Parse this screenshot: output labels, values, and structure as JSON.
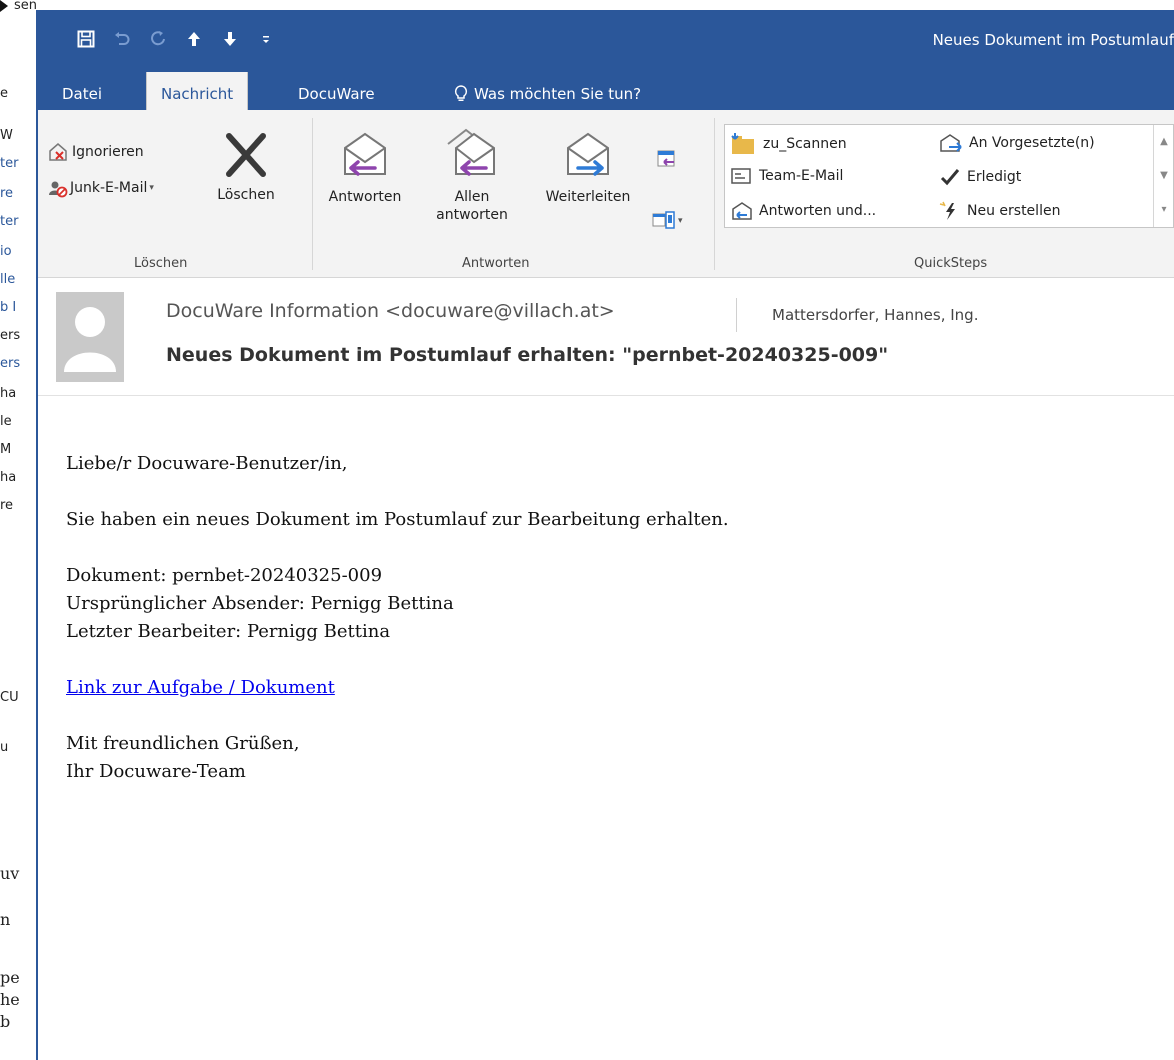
{
  "background_window": {
    "top_text": "sen",
    "fragments": [
      {
        "text": "e",
        "style": ""
      },
      {
        "text": "W",
        "style": ""
      },
      {
        "text": "ter",
        "style": "blue"
      },
      {
        "text": "re",
        "style": "blue"
      },
      {
        "text": "ter",
        "style": "blue"
      },
      {
        "text": "io",
        "style": "blue"
      },
      {
        "text": "lle",
        "style": "blue"
      },
      {
        "text": "b I",
        "style": "blue"
      },
      {
        "text": "ers",
        "style": ""
      },
      {
        "text": "ers",
        "style": "blue"
      },
      {
        "text": "ha",
        "style": ""
      },
      {
        "text": "le",
        "style": ""
      },
      {
        "text": "M",
        "style": ""
      },
      {
        "text": "ha",
        "style": ""
      },
      {
        "text": "re",
        "style": ""
      },
      {
        "text": "CU",
        "style": ""
      },
      {
        "text": "u",
        "style": ""
      },
      {
        "text": "uv",
        "style": "serif"
      },
      {
        "text": "n",
        "style": "serif"
      },
      {
        "text": "pe",
        "style": "serif"
      },
      {
        "text": "he",
        "style": "serif"
      },
      {
        "text": "b",
        "style": "serif"
      }
    ]
  },
  "window": {
    "title": "Neues Dokument im Postumlauf",
    "titlebar_color": "#2b579a",
    "qat_icons": [
      "save-icon",
      "undo-icon",
      "redo-icon",
      "up-arrow-icon",
      "down-arrow-icon",
      "customize-icon"
    ]
  },
  "tabs": {
    "datei": "Datei",
    "nachricht": "Nachricht",
    "docuware": "DocuWare",
    "tell_me": "Was möchten Sie tun?"
  },
  "ribbon": {
    "loeschen_group": {
      "ignorieren": "Ignorieren",
      "junk": "Junk-E-Mail",
      "loeschen": "Löschen",
      "label": "Löschen"
    },
    "antworten_group": {
      "antworten": "Antworten",
      "allen_line1": "Allen",
      "allen_line2": "antworten",
      "weiterleiten": "Weiterleiten",
      "label": "Antworten"
    },
    "quicksteps": {
      "items": [
        "zu_Scannen",
        "Team-E-Mail",
        "Antworten und...",
        "An Vorgesetzte(n)",
        "Erledigt",
        "Neu erstellen"
      ],
      "label": "QuickSteps"
    }
  },
  "message": {
    "sender": "DocuWare Information <docuware@villach.at>",
    "to": "Mattersdorfer, Hannes, Ing.",
    "subject": "Neues Dokument im Postumlauf erhalten: \"pernbet-20240325-009\""
  },
  "body": {
    "greeting": "Liebe/r Docuware-Benutzer/in,",
    "intro": "Sie haben ein neues Dokument im Postumlauf zur Bearbeitung erhalten.",
    "dokument": "Dokument: pernbet-20240325-009",
    "absender": "Ursprünglicher Absender: Pernigg Bettina",
    "bearbeiter": "Letzter Bearbeiter: Pernigg Bettina",
    "link": "Link zur Aufgabe / Dokument",
    "closing": "Mit freundlichen Grüßen,",
    "signature": "Ihr Docuware-Team"
  }
}
